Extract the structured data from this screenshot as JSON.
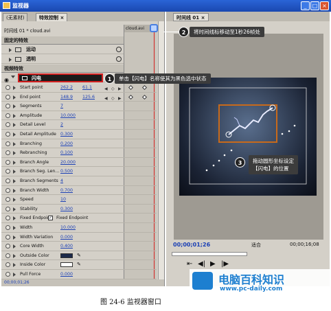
{
  "window": {
    "title": "监视器"
  },
  "left_panel": {
    "tabs": [
      "(无素材)",
      "特效控制",
      "×"
    ],
    "clip_label": "时间线 01 * cloud.avi",
    "mini_clip": "cloud.avi",
    "fixed_effects": "固定的特效",
    "motion": "运动",
    "opacity": "透明",
    "video_effects": "视频特效",
    "effect_name": "闪电",
    "params": [
      {
        "label": "Start point",
        "v1": "262.2",
        "v2": "61.1"
      },
      {
        "label": "End point",
        "v1": "148.9",
        "v2": "125.6"
      },
      {
        "label": "Segments",
        "v1": "7"
      },
      {
        "label": "Amplitude",
        "v1": "10.000"
      },
      {
        "label": "Detail Level",
        "v1": "2"
      },
      {
        "label": "Detail Amplitude",
        "v1": "0.300"
      },
      {
        "label": "Branching",
        "v1": "0.200"
      },
      {
        "label": "Rebranching",
        "v1": "0.100"
      },
      {
        "label": "Branch Angle",
        "v1": "20.000"
      },
      {
        "label": "Branch Seg. Len...",
        "v1": "0.500"
      },
      {
        "label": "Branch Segments",
        "v1": "4"
      },
      {
        "label": "Branch Width",
        "v1": "0.700"
      },
      {
        "label": "Speed",
        "v1": "10"
      },
      {
        "label": "Stability",
        "v1": "0.300"
      },
      {
        "label": "Fixed Endpoint",
        "v1": "Fixed Endpoint"
      },
      {
        "label": "Width",
        "v1": "10.000"
      },
      {
        "label": "Width Variation",
        "v1": "0.000"
      },
      {
        "label": "Core Width",
        "v1": "0.400"
      },
      {
        "label": "Outside Color",
        "v1": ""
      },
      {
        "label": "Inside Color",
        "v1": ""
      },
      {
        "label": "Pull Force",
        "v1": "0.000"
      }
    ],
    "timecode": "00;00;01;26"
  },
  "right_panel": {
    "tab": "时间线 01",
    "timecode": "00;00;01;26",
    "fit": "适合",
    "duration": "00;00;16;08"
  },
  "callouts": {
    "c1": "单击【闪电】名称使其为黑色选中状态",
    "c2": "将时间线标移动至1秒26帧处",
    "c3_line1": "拖动圆形坐标设定",
    "c3_line2": "【闪电】的位置",
    "n1": "1",
    "n2": "2",
    "n3": "3"
  },
  "caption": {
    "text": "图 24-6   监视器窗口"
  },
  "watermark": {
    "title": "电脑百科知识",
    "url": "www.pc-daily.com"
  },
  "colors": {
    "accent": "#d42020",
    "selection": "#1a1a1a",
    "link": "#1a3fb5"
  }
}
